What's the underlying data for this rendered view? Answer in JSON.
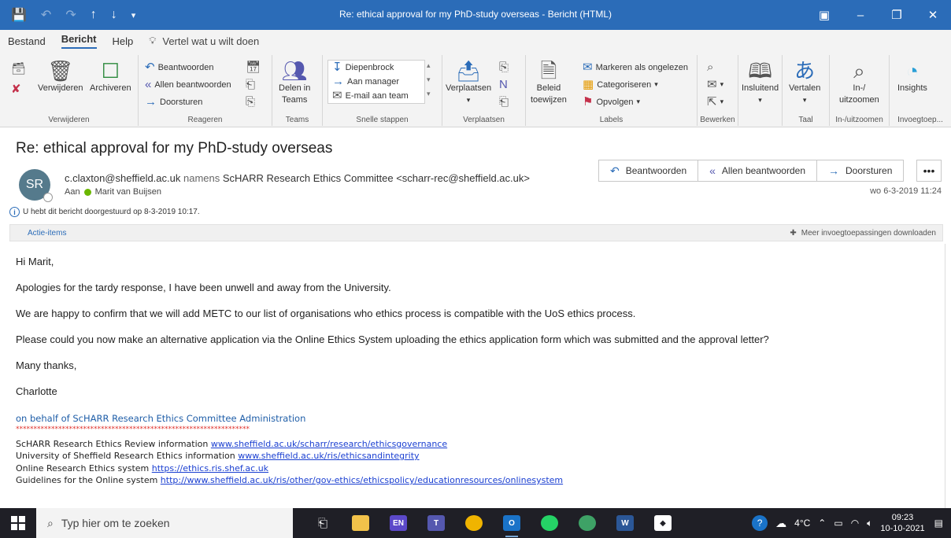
{
  "titlebar": {
    "title": "Re: ethical approval for my PhD-study overseas  -  Bericht (HTML)",
    "qat": [
      "save-icon",
      "undo-icon",
      "redo-icon",
      "up-arrow-icon",
      "down-arrow-icon",
      "customize-icon"
    ]
  },
  "menu": {
    "tabs": [
      "Bestand",
      "Bericht",
      "Help"
    ],
    "tell": "Vertel wat u wilt doen"
  },
  "ribbon": {
    "delete": {
      "verwijderen": "Verwijderen",
      "archiveren": "Archiveren",
      "label": "Verwijderen"
    },
    "respond": {
      "beantwoorden": "Beantwoorden",
      "allen": "Allen beantwoorden",
      "doorsturen": "Doorsturen",
      "label": "Reageren"
    },
    "teams": {
      "delen": "Delen in",
      "delen2": "Teams",
      "label": "Teams"
    },
    "quick": {
      "diepenbrock": "Diepenbrock",
      "manager": "Aan manager",
      "email_team": "E-mail aan team",
      "label": "Snelle stappen"
    },
    "move": {
      "verplaatsen": "Verplaatsen",
      "label": "Verplaatsen"
    },
    "labels": {
      "beleid": "Beleid",
      "toewijzen": "toewijzen",
      "ongelezen": "Markeren als ongelezen",
      "categoriseren": "Categoriseren",
      "opvolgen": "Opvolgen",
      "label": "Labels"
    },
    "edit": {
      "label": "Bewerken"
    },
    "insluitend": {
      "text": "Insluitend"
    },
    "language": {
      "vertalen": "Vertalen",
      "label": "Taal"
    },
    "zoom": {
      "in": "In-/",
      "uit": "uitzoomen",
      "label": "In-/uitzoomen"
    },
    "insights": {
      "text": "Insights",
      "label": "Invoegtoep..."
    }
  },
  "message": {
    "subject": "Re: ethical approval for my PhD-study overseas",
    "avatar": "SR",
    "from_email": "c.claxton@sheffield.ac.uk",
    "from_namens": "namens",
    "from_name": "ScHARR Research Ethics Committee <scharr-rec@sheffield.ac.uk>",
    "to_label": "Aan",
    "to_name": "Marit van Buijsen",
    "reply": "Beantwoorden",
    "reply_all": "Allen beantwoorden",
    "forward": "Doorsturen",
    "more": "•••",
    "date": "wo 6-3-2019 11:24",
    "info": "U hebt dit bericht doorgestuurd op 8-3-2019 10:17.",
    "actie": "Actie-items",
    "meer": "Meer invoegtoepassingen downloaden"
  },
  "body": {
    "p1": "Hi Marit,",
    "p2": "Apologies for the tardy response, I have been unwell and away from the University.",
    "p3": "We are happy to confirm that we will add METC to our list of organisations who ethics process is compatible with the UoS ethics process.",
    "p4": "Please could you now make an alternative application via the Online Ethics System uploading the ethics application form which was submitted and the approval letter?",
    "p5": "Many thanks,",
    "p6": "Charlotte"
  },
  "signature": {
    "org": "on behalf of ScHARR Research Ethics Committee Administration",
    "stars": "******************************************************************",
    "l1_text": "ScHARR Research Ethics Review information",
    "l1_link": "www.sheffield.ac.uk/scharr/research/ethicsgovernance",
    "l2_text": "University of Sheffield Research Ethics information",
    "l2_link": "www.sheffield.ac.uk/ris/ethicsandintegrity",
    "l3_text": "Online Research Ethics system",
    "l3_link": "https://ethics.ris.shef.ac.uk",
    "l4_text": "Guidelines for the Online system",
    "l4_link": "http://www.sheffield.ac.uk/ris/other/gov-ethics/ethicspolicy/educationresources/onlinesystem"
  },
  "taskbar": {
    "search_placeholder": "Typ hier om te zoeken",
    "weather": "4°C",
    "time": "09:23",
    "date": "10-10-2021"
  },
  "colors": {
    "accent": "#2b6cb8",
    "link": "#1a3fd1",
    "stars": "#e0312b",
    "taskbar": "#1f1f26"
  }
}
